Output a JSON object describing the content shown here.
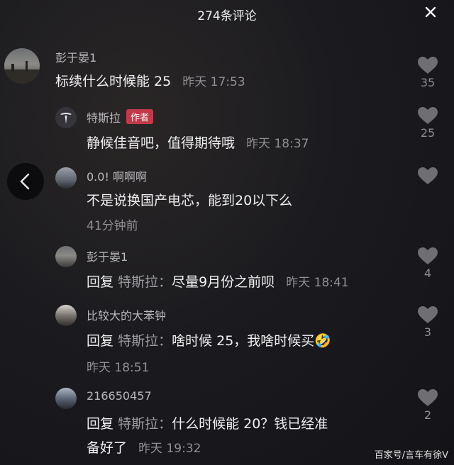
{
  "header": {
    "title": "274条评论"
  },
  "comments": [
    {
      "name": "彭于晏1",
      "text": "标续什么时候能 25",
      "time": "昨天 17:53",
      "likes": "35"
    },
    {
      "name": "特斯拉",
      "badge": "作者",
      "text": "静候佳音吧，值得期待哦",
      "time": "昨天 18:37",
      "likes": "25"
    },
    {
      "name": "0.0!  啊啊啊",
      "text": "不是说换国产电芯，能到20以下么",
      "time": "41分钟前",
      "likes": ""
    },
    {
      "name": "彭于晏1",
      "reply_prefix": "回复",
      "reply_target": "特斯拉：",
      "text": "尽量9月份之前呗",
      "time": "昨天 18:41",
      "likes": "4"
    },
    {
      "name": "比较大的大苯钟",
      "reply_prefix": "回复",
      "reply_target": "特斯拉：",
      "text": "啥时候 25，我啥时候买",
      "emoji": "🤣",
      "time": "昨天 18:51",
      "likes": "3"
    },
    {
      "name": "216650457",
      "reply_prefix": "回复",
      "reply_target": "特斯拉：",
      "text": "什么时候能 20？钱已经准",
      "text2": "备好了",
      "time": "昨天 19:32",
      "likes": "2"
    }
  ],
  "watermark": "百家号/言车有徐V",
  "colors": {
    "author_badge": "#c23a4a",
    "background": "#1a1a1e"
  }
}
